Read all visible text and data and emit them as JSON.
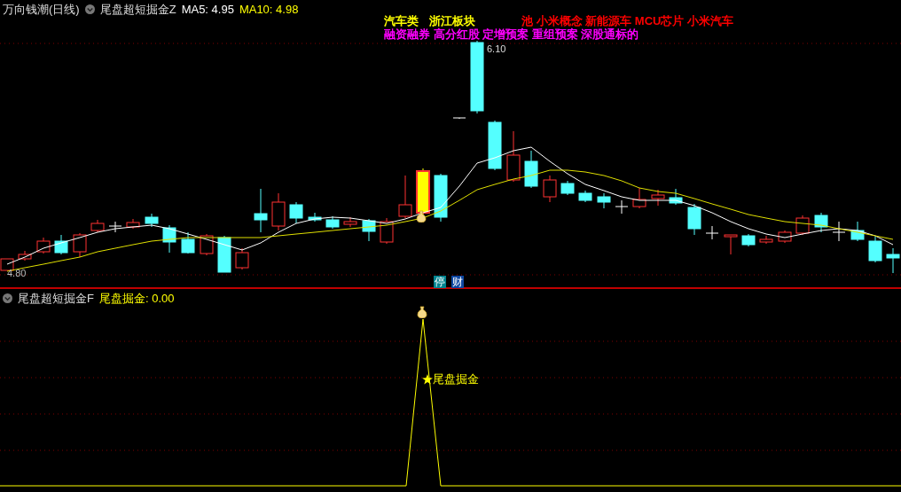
{
  "main_panel": {
    "stock_title": "万向钱潮(日线)",
    "indicator_name": "尾盘超短掘金Z",
    "ma_readings": [
      {
        "label": "MA5: 4.95",
        "color": "#ffffff"
      },
      {
        "label": "MA10: 4.98",
        "color": "#ffff00"
      }
    ],
    "tags": [
      [
        {
          "text": "汽车类",
          "color": "#ffff00"
        },
        {
          "text": "浙江板块",
          "color": "#ffff00"
        },
        {
          "text": "池 小米概念 新能源车 MCU芯片 小米汽车",
          "color": "#ff0000"
        }
      ],
      [
        {
          "text": "融资融券 高分红股 定增预案 重组预案 深股通标的",
          "color": "#ff00ff"
        }
      ]
    ],
    "high_label": "6.10",
    "low_label": "4.80",
    "badges": [
      {
        "text": "停",
        "color": "#00838f"
      },
      {
        "text": "财",
        "color": "#0d47a1"
      }
    ]
  },
  "sub_panel": {
    "indicator_name": "尾盘超短掘金F",
    "reading": "尾盘掘金: 0.00",
    "signal_label": "尾盘掘金"
  }
}
